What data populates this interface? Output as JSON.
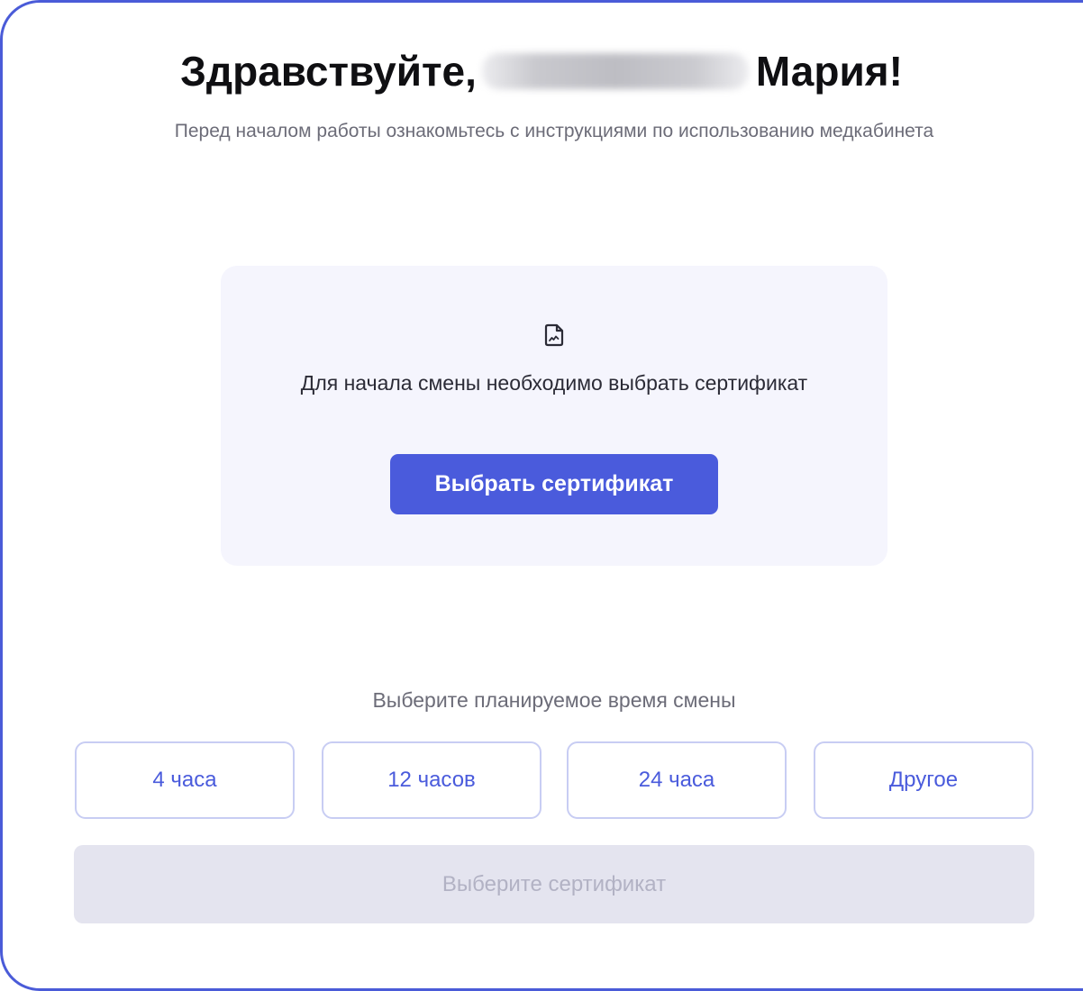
{
  "greeting": {
    "prefix": "Здравствуйте,",
    "suffix": "Мария!"
  },
  "subtitle": "Перед началом работы ознакомьтесь с инструкциями по использованию медкабинета",
  "certificate_card": {
    "icon": "document-signature-icon",
    "message": "Для начала смены необходимо выбрать сертификат",
    "button_label": "Выбрать сертификат"
  },
  "shift_time": {
    "label": "Выберите планируемое время смены",
    "options": [
      "4 часа",
      "12 часов",
      "24 часа",
      "Другое"
    ]
  },
  "submit": {
    "label": "Выберите сертификат",
    "disabled": true
  },
  "colors": {
    "accent": "#4a5bdc",
    "frame_border": "#4a5bd8",
    "card_background": "#f5f5fd",
    "option_border": "#c8cdf3",
    "disabled_background": "#e4e4ef",
    "disabled_text": "#b2b2c4",
    "muted_text": "#6c6c78"
  }
}
